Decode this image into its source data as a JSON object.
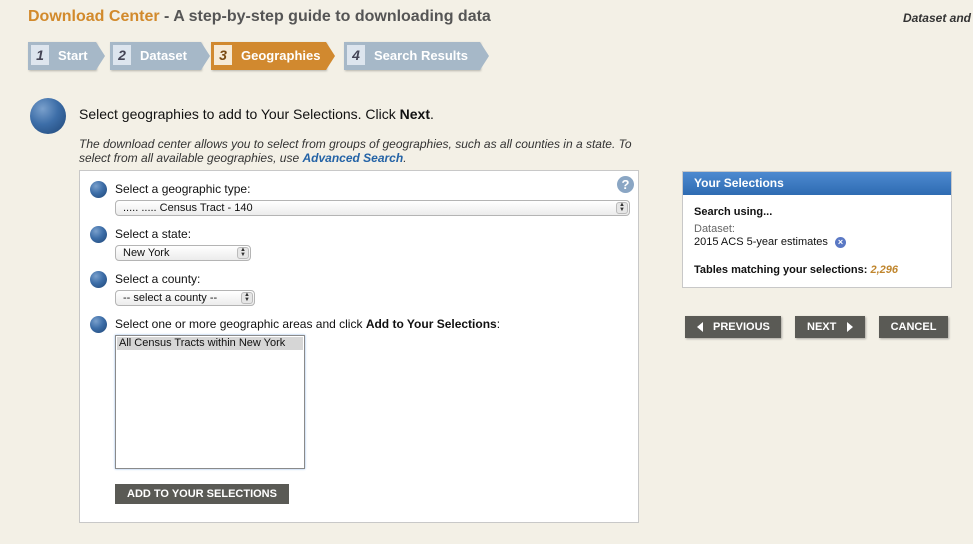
{
  "header": {
    "brand": "Download Center",
    "title": " - A step-by-step guide to downloading data",
    "right": "Dataset and"
  },
  "steps": [
    {
      "num": "1",
      "label": "Start"
    },
    {
      "num": "2",
      "label": "Dataset"
    },
    {
      "num": "3",
      "label": "Geographies"
    },
    {
      "num": "4",
      "label": "Search Results"
    }
  ],
  "active_step": "3",
  "instruction": {
    "text": "Select geographies to add to Your Selections. Click ",
    "bold": "Next",
    "end": "."
  },
  "intro": {
    "text": "The download center allows you to select from groups of geographies, such as all counties in a state. To select from all available geographies, use ",
    "link": "Advanced Search",
    "end": "."
  },
  "form": {
    "help_icon": "?",
    "geo_type": {
      "label": "Select a geographic type:",
      "value": "..... ..... Census Tract - 140"
    },
    "state": {
      "label": "Select a state:",
      "value": "New York"
    },
    "county": {
      "label": "Select a county:",
      "value": "-- select a county --"
    },
    "areas": {
      "label": "Select one or more geographic areas and click ",
      "label_bold": "Add to Your Selections",
      "label_end": ":",
      "options": [
        "All Census Tracts within New York"
      ]
    },
    "add_button": "ADD TO YOUR SELECTIONS"
  },
  "selections": {
    "title": "Your Selections",
    "search_using": "Search using...",
    "dataset_label": "Dataset:",
    "dataset_value": "2015 ACS 5-year estimates",
    "remove_icon": "×",
    "matching_label": "Tables matching your selections: ",
    "matching_count": "2,296"
  },
  "nav": {
    "previous": "PREVIOUS",
    "next": "NEXT",
    "cancel": "CANCEL"
  }
}
